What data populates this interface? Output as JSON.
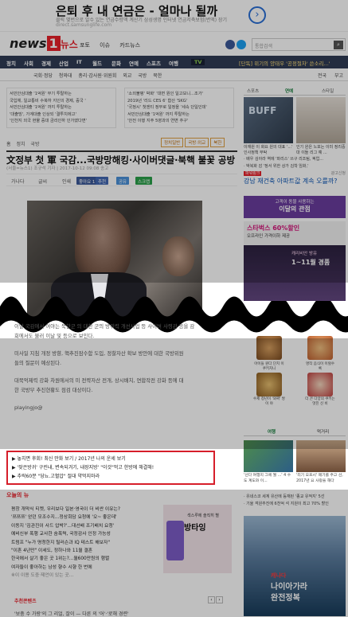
{
  "ad_banner": {
    "title": "은퇴 후 내 연금은 - 얼마나 될까",
    "subtitle": "클릭 몇번으로 알수 있는 연금수령액 계산기 삼성생명 인터넷 연금저축보험(변액) 장기",
    "url": "direct.samsunglife.com",
    "arrow": "›"
  },
  "header": {
    "logo_news": "news",
    "logo_one": "1",
    "logo_ko": "뉴스",
    "logo_tagline": "SIZE",
    "links": [
      "포토",
      "이슈",
      "카드뉴스"
    ],
    "search_placeholder": "통합검색"
  },
  "nav": {
    "items": [
      "정치",
      "사회",
      "경제",
      "산업",
      "IT",
      "월드",
      "문화",
      "연예",
      "스포츠",
      "여행"
    ],
    "tv": "TV",
    "ticker": "[단독] 위기의 양태우 '공정절차' 쓴소리...'"
  },
  "subnav": {
    "items": [
      "국회·정당",
      "청와대",
      "총리·감사원·위원회",
      "외교",
      "국방",
      "북한"
    ],
    "right": [
      "전국",
      "부고"
    ]
  },
  "news_boxes": [
    [
      "서민안심대출 '1억원' 무기 투탈하는",
      "국입체, 일교통비 수북하 지인의 경제, 중국 '",
      "서민안심대출 '1억원' 까지 투탈하는",
      "'대출빙', 가계대출 인상되 '결투치에고'",
      "'인천지 외국 현물 증대 금리인하 인가였다면'"
    ],
    [
      "'소외불평' 박화' '대면 원인 일고보니...조가'",
      "2019년 '리드 CES 6' 합산 'SKG'",
      "'국정시' 첫엔티 정부로 일정을 '세속 단일인데'",
      "서민안심대출 '1억원' 까지 투탈하는",
      "'안전 이행 지주 5영과의 연변 추구'"
    ]
  ],
  "article": {
    "breadcrumb": [
      "홈",
      "정치",
      "국방"
    ],
    "tags": [
      "정치일반",
      "국방·외교",
      "북한"
    ],
    "headline": "文정부 첫 軍 국감...국방망해킹·사이버댓글·북핵 불꽃 공방",
    "meta": "(서울=뉴스1) 조규석 기자 | 2017-10-12 09:08 송고",
    "tools": [
      "가나다",
      "글씨",
      "인쇄"
    ],
    "buttons": [
      "좋아요 1",
      "추천",
      "공유",
      "스크랩"
    ],
    "paragraphs": [
      "이날 국감에서 여야는 북한군 의 대한 군의 방위력 개선사업 등 사이버 사령관 등을 감",
      "회에서도 불러 이날 및 등으로 보인다.",
      "미사일 지침 개정 방향, 핵추진잠수함 도입, 정찰자산 확보 방안에 대한 국방위원",
      "들의 질문이 예상된다.",
      "대북억제력 강화 차원에서의 미 전략자산 전개, 상시배치, 연합작전 강화 등에 대",
      "한 국방부 추진현황도 점검 대상이다."
    ],
    "signature": "playingjo@"
  },
  "promo_box": {
    "items": [
      "▶ 놓치면 후회! 최신 만화 보기 / 2017년 나의 운세 보기",
      "▶ '잦은방귀' 구린내, 변속되겨기, 내장지방' \"이것\"먹고 한방에 해결해!",
      "▶ 추락60분 \"당뇨.고혈압\" 절대 약먹지마라"
    ]
  },
  "popular": {
    "title": "오늘의 뉴",
    "items": [
      "평창 개막식 티켓, 우리보다 일본·영국이 더 비싼 이유는?",
      "'쯔쯔쯔' 얻던 모조수지...정상회담 요청에 '오~ 좋은데'",
      "이동지 '김관진이 사드 압박?'...대선배 조기배치 요청'",
      "예비신부 폭행 교사한 숨폭력, 국정감사 인정 가능성",
      "트럼프 \"누가 명청한지 틸러슨과 IQ 테스트 해보자\"",
      "\"이혼 4년만\" 이세도, 정하나와 11월 결혼",
      "한국에서 살기 좋은 곳 1위는?...월600만원의 행렬",
      "여자들이 좋아하는 남성 향수 시향 한 번에"
    ],
    "ad_text": "섹스루에 솔직히 별",
    "ad_big": "방타잉",
    "footer_note": "※이 이용 도중·제언이 있는 곳..."
  },
  "bottom": {
    "title": "추천콘텐츠",
    "nav_prev": "‹",
    "nav_next": "›",
    "line": "'보충 수 가랑'의 그 리얼, 잘이 — 다른 의 '어'·'로해 경련'"
  },
  "right_col": {
    "tabs": [
      "스포츠",
      "연예",
      "스타일"
    ],
    "pic1_label": "BUFF",
    "captions": [
      "이재원 이 화요 원의 대표 '...' 인사정책 부탁",
      "인기 원은 노포는 이미 정리중대 이들 리그 예 ..."
    ],
    "list": [
      "· 배우 김아라 역에 '파리스' 쓰구 리조팀, 픽업...",
      "· 박복화 감 '정서 위한 상가 김학 임화,'"
    ],
    "ad_label": "파워링크",
    "ad_label_right": "광고신청",
    "ad1": "강남 재건축 아파트값 계속 오를까?",
    "ad2_line1": "고객이 동물 사용하는",
    "ad2_line2": "이달의 관점",
    "ad3_line1": "스타벅스 60%할인",
    "ad3_line2": "오프라인 가격이하 제공",
    "ad4_line1": "캐리비안 방유",
    "ad4_line2": "1~11월 경품",
    "food_captions": [
      "아이들 원다 단치 이 쿠키치니",
      "명작 음식이 이럴수록",
      "수제 청년이 '와짜' 쌍이 야",
      "더 큰 다양의 쿠키는 멋진 신 비"
    ],
    "tabs2": [
      "여행",
      "먹거리"
    ],
    "captions2": [
      "'선다 여행지 그에 월 ...' 4 수도 계도와 이...",
      "'리기 오프시' 매기를 주고 선, 2017년 요 사랑을 해다"
    ],
    "list2": [
      "· 유네스코 세계 유산에 등재된 '종교 유적지' 5선",
      "· 기울 객원추진에 6천억 석 지원이 최고 70% 할인"
    ],
    "ad5_line1": "캐나다",
    "ad5_line2": "나이아가라",
    "ad5_line3": "완전정복"
  },
  "colors": {
    "nav_bg": "#2f3b55",
    "accent_red": "#e8202a",
    "promo_border": "#d61e2a",
    "link_blue": "#0a55b5"
  }
}
